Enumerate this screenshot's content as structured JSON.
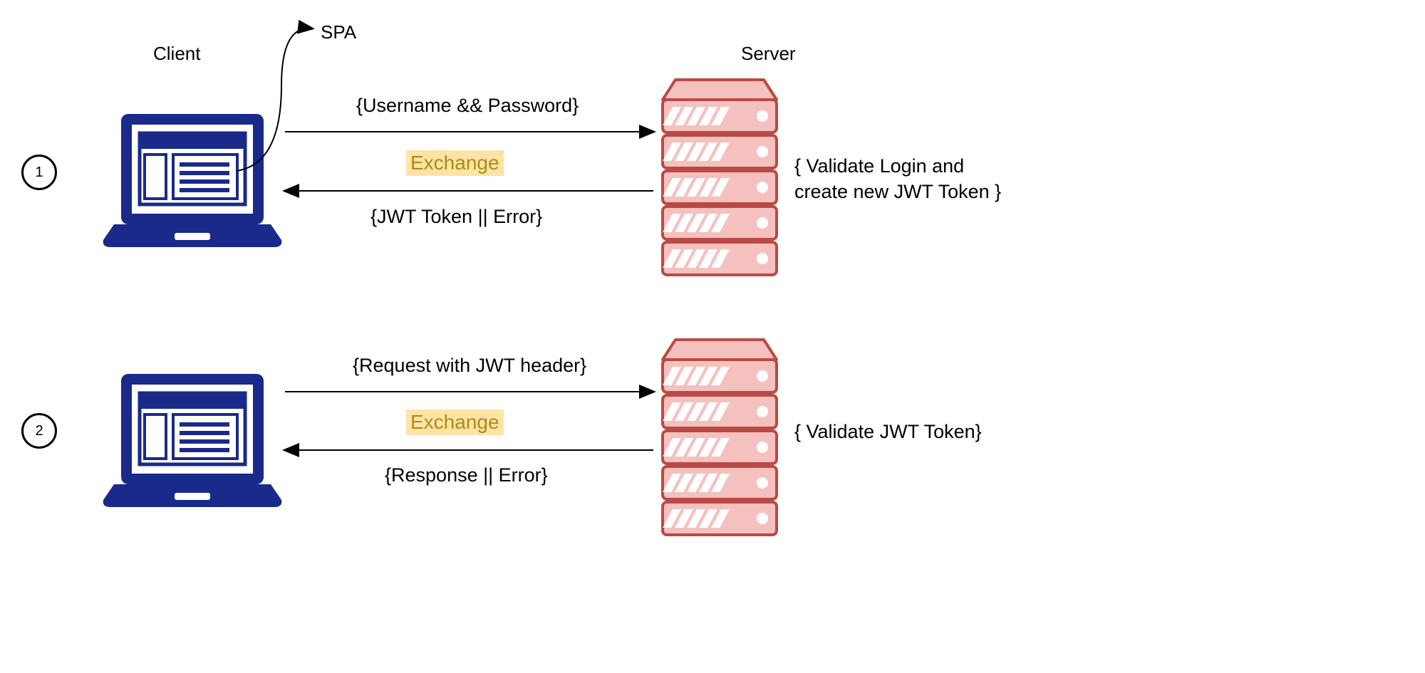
{
  "headers": {
    "client": "Client",
    "server": "Server",
    "spa": "SPA"
  },
  "steps": [
    {
      "number": "1",
      "request": "{Username && Password}",
      "exchange": "Exchange",
      "response": "{JWT Token || Error}",
      "server_note": "{ Validate Login and\ncreate new JWT Token }"
    },
    {
      "number": "2",
      "request": "{Request with JWT header}",
      "exchange": "Exchange",
      "response": "{Response || Error}",
      "server_note": "{ Validate JWT Token}"
    }
  ],
  "colors": {
    "laptop": "#1a2a8a",
    "server_fill": "#f5c1bf",
    "server_stroke": "#ba4a44",
    "highlight_bg": "#fde4a5",
    "highlight_text": "#b08a1a"
  }
}
